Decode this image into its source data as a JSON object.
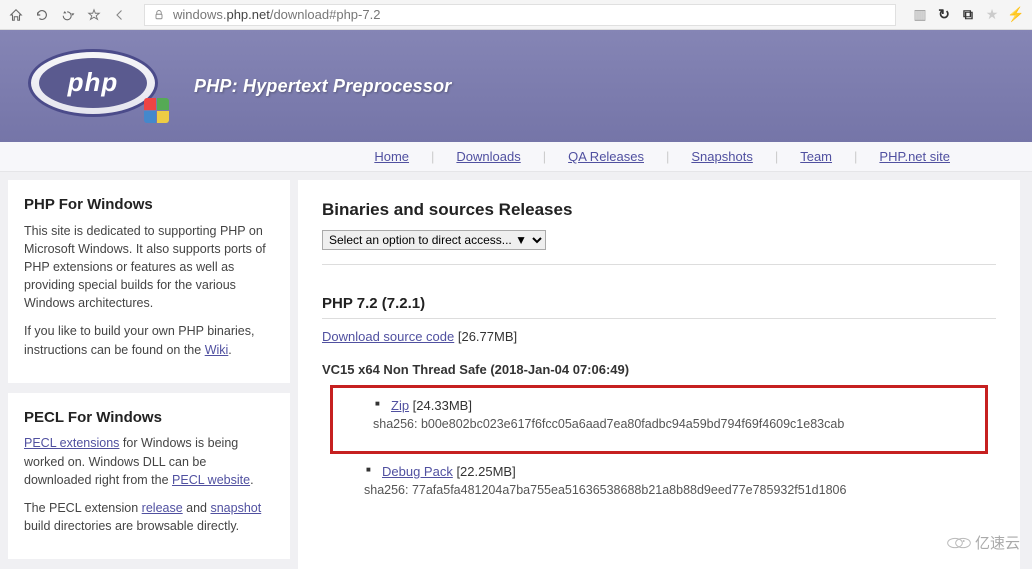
{
  "browser": {
    "url_prefix": "windows.",
    "url_domain": "php.net",
    "url_path": "/download#php-7.2"
  },
  "header": {
    "logo_text": "php",
    "tagline": "PHP: Hypertext Preprocessor"
  },
  "nav": {
    "items": [
      "Home",
      "Downloads",
      "QA Releases",
      "Snapshots",
      "Team",
      "PHP.net site"
    ]
  },
  "sidebar": {
    "box1": {
      "title": "PHP For Windows",
      "p1": "This site is dedicated to supporting PHP on Microsoft Windows. It also supports ports of PHP extensions or features as well as providing special builds for the various Windows architectures.",
      "p2a": "If you like to build your own PHP binaries, instructions can be found on the ",
      "p2_link": "Wiki",
      "p2b": "."
    },
    "box2": {
      "title": "PECL For Windows",
      "p1a": "",
      "p1_link1": "PECL extensions",
      "p1b": " for Windows is being worked on. Windows DLL can be downloaded right from the ",
      "p1_link2": "PECL website",
      "p1c": ".",
      "p2a": "The PECL extension ",
      "p2_link1": "release",
      "p2b": " and ",
      "p2_link2": "snapshot",
      "p2c": " build directories are browsable directly."
    }
  },
  "main": {
    "releases_title": "Binaries and sources Releases",
    "select_placeholder": "Select an option to direct access... ▼",
    "version_title": "PHP 7.2 (7.2.1)",
    "source_link": "Download source code",
    "source_size": " [26.77MB]",
    "build_head": "VC15 x64 Non Thread Safe (2018-Jan-04 07:06:49)",
    "zip_link": "Zip",
    "zip_size": " [24.33MB]",
    "zip_sha": "sha256: b00e802bc023e617f6fcc05a6aad7ea80fadbc94a59bd794f69f4609c1e83cab",
    "debug_link": "Debug Pack",
    "debug_size": " [22.25MB]",
    "debug_sha": "sha256: 77afa5fa481204a7ba755ea51636538688b21a8b88d9eed77e785932f51d1806"
  },
  "watermark": "亿速云"
}
